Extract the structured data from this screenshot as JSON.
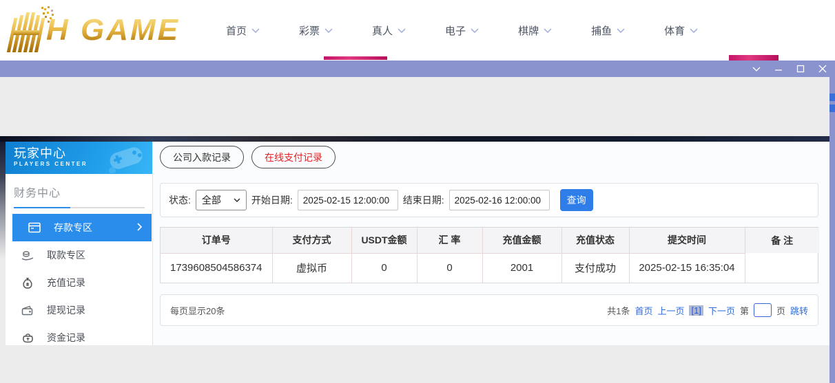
{
  "logo": {
    "brand": "HH GAME",
    "text": "H GAME"
  },
  "nav": {
    "items": [
      {
        "label": "首页"
      },
      {
        "label": "彩票"
      },
      {
        "label": "真人"
      },
      {
        "label": "电子"
      },
      {
        "label": "棋牌"
      },
      {
        "label": "捕鱼"
      },
      {
        "label": "体育"
      }
    ]
  },
  "titlebar": {
    "controls": [
      "chevron-down",
      "minimize",
      "maximize",
      "close"
    ]
  },
  "sidebar": {
    "header": {
      "title": "玩家中心",
      "subtitle": "PLAYERS  CENTER"
    },
    "section": "财务中心",
    "items": [
      {
        "label": "存款专区",
        "icon": "deposit-card-icon",
        "active": true
      },
      {
        "label": "取款专区",
        "icon": "hand-coins-icon",
        "active": false
      },
      {
        "label": "充值记录",
        "icon": "money-bag-icon",
        "active": false
      },
      {
        "label": "提现记录",
        "icon": "wallet-icon",
        "active": false
      },
      {
        "label": "资金记录",
        "icon": "purse-icon",
        "active": false
      }
    ]
  },
  "tabs": [
    {
      "label": "公司入款记录",
      "style": "default"
    },
    {
      "label": "在线支付记录",
      "style": "red"
    }
  ],
  "filters": {
    "status_label": "状态:",
    "status_value": "全部",
    "start_label": "开始日期:",
    "start_value": "2025-02-15 12:00:00",
    "end_label": "结束日期:",
    "end_value": "2025-02-16 12:00:00",
    "query_label": "查询"
  },
  "table": {
    "headers": [
      "订单号",
      "支付方式",
      "USDT金额",
      "汇 率",
      "充值金额",
      "充值状态",
      "提交时间",
      "备 注"
    ],
    "rows": [
      [
        "1739608504586374",
        "虚拟币",
        "0",
        "0",
        "2001",
        "支付成功",
        "2025-02-15 16:35:04",
        ""
      ]
    ]
  },
  "pagination": {
    "page_size_text": "每页显示20条",
    "total_text": "共1条",
    "first_label": "首页",
    "prev_label": "上一页",
    "current_label": "[1]",
    "next_label": "下一页",
    "jump_prefix": "第",
    "jump_value": "",
    "jump_suffix": "页",
    "jump_label": "跳转"
  },
  "colors": {
    "titlebar": "#8b93cf",
    "sidebar_header_blue": "#1e9ae7",
    "active_item_blue": "#2a8ceb",
    "query_button_blue": "#2e7de8",
    "link_blue": "#2f6bd8",
    "tab_red": "#e02222",
    "logo_gold": "#eabc4a",
    "table_border_pink": "#ead6d6",
    "status_success_text": "支付成功"
  }
}
